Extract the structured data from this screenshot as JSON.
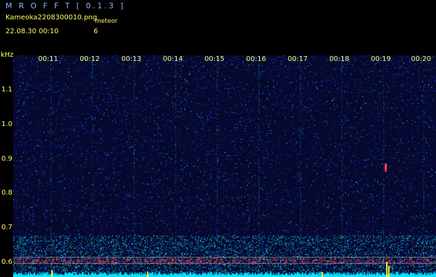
{
  "header": {
    "app_title": "M R O F F T  [ 0.1.3 ]",
    "file_name": "Kameoka2208300010.png",
    "meteor_label": "meteor",
    "timestamp": "22.08.30  00:10",
    "meteor_count": "6"
  },
  "spectrogram": {
    "unit_label": "kHz",
    "time_ticks": [
      "00:11",
      "00:12",
      "00:13",
      "00:14",
      "00:15",
      "00:16",
      "00:17",
      "00:18",
      "00:19",
      "00:20"
    ],
    "freq_ticks": [
      "1.1",
      "1.0",
      "0.9",
      "0.8",
      "0.7",
      "0.6"
    ],
    "colors": {
      "background": "#06082e",
      "text": "#ffff66",
      "noise_low": "#1a3cff",
      "noise_mid": "#00c8ff",
      "noise_high": "#44ff88",
      "carrier": "#ff3040",
      "meteor": "#ffff40",
      "baseline": "#00e5ff"
    }
  }
}
